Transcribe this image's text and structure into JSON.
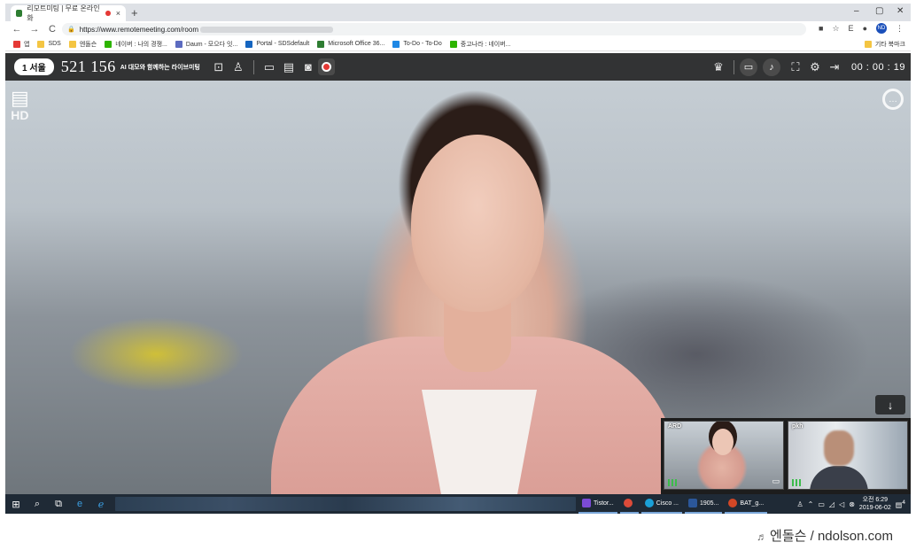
{
  "browser": {
    "tab_title": "리모트미팅 | 무료 온라인 화",
    "close_glyph": "×",
    "new_tab_glyph": "+",
    "window_controls": [
      "–",
      "▢",
      "✕"
    ],
    "nav": [
      "←",
      "→",
      "C"
    ],
    "url": "https://www.remotemeeting.com/room",
    "profile_initials": "ND",
    "bookmarks": [
      {
        "label": "앱",
        "color": "#e53935"
      },
      {
        "label": "SDS",
        "color": "#f4c542"
      },
      {
        "label": "엔돌슨",
        "color": "#f4c542"
      },
      {
        "label": "네이버 : 나의 경쟁...",
        "color": "#2db400"
      },
      {
        "label": "Daum - 모으다 잇...",
        "color": "#5c6bc0"
      },
      {
        "label": "Portal - SDSdefault",
        "color": "#1565c0"
      },
      {
        "label": "Microsoft Office 36...",
        "color": "#2e7d32"
      },
      {
        "label": "To-Do - To-Do",
        "color": "#1e88e5"
      },
      {
        "label": "중고나라 : 네이버...",
        "color": "#2db400"
      }
    ],
    "other_bookmarks": "기타 북마크"
  },
  "meeting": {
    "room_badge": "1 서울",
    "room_id": "521 156",
    "room_subtitle": "AI 대모와 함께하는 라이브미팅",
    "timer": "00 : 00 : 19",
    "quality_label": "HD",
    "participants": [
      {
        "name": "ARD"
      },
      {
        "name": "pkh"
      }
    ]
  },
  "icons": {
    "down": "↓",
    "screen": "▭"
  },
  "taskbar": {
    "apps": [
      {
        "label": "Tistor...",
        "color": "#7b4bd6"
      },
      {
        "label": "",
        "color": "#dd4b39"
      },
      {
        "label": "Cisco ...",
        "color": "#1ba0d7"
      },
      {
        "label": "1905...",
        "color": "#2b579a"
      },
      {
        "label": "BAT_g...",
        "color": "#d24726"
      }
    ],
    "time": "오전 6:29",
    "date": "2019-06-02",
    "notification_count": "4"
  },
  "credit": {
    "note_glyph": "♬",
    "text": "엔돌슨 / ndolson.com"
  }
}
